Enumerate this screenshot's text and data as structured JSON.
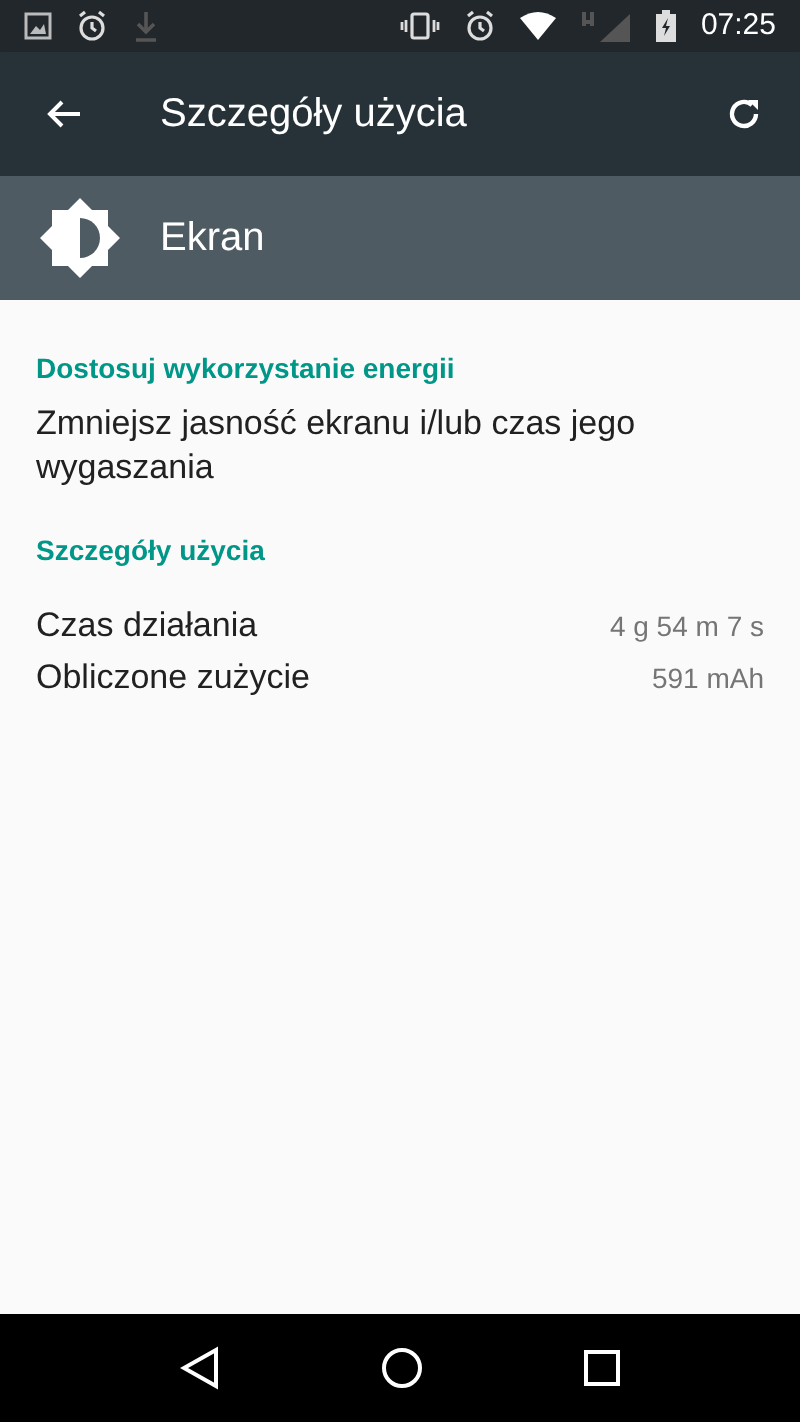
{
  "status_bar": {
    "time": "07:25"
  },
  "toolbar": {
    "title": "Szczegóły użycia"
  },
  "header": {
    "title": "Ekran"
  },
  "sections": [
    {
      "title": "Dostosuj wykorzystanie energii",
      "kind": "action",
      "items": [
        {
          "text": "Zmniejsz jasność ekranu i/lub czas jego wygaszania"
        }
      ]
    },
    {
      "title": "Szczegóły użycia",
      "kind": "details",
      "items": [
        {
          "label": "Czas działania",
          "value": "4 g 54 m 7 s"
        },
        {
          "label": "Obliczone zużycie",
          "value": "591 mAh"
        }
      ]
    }
  ]
}
